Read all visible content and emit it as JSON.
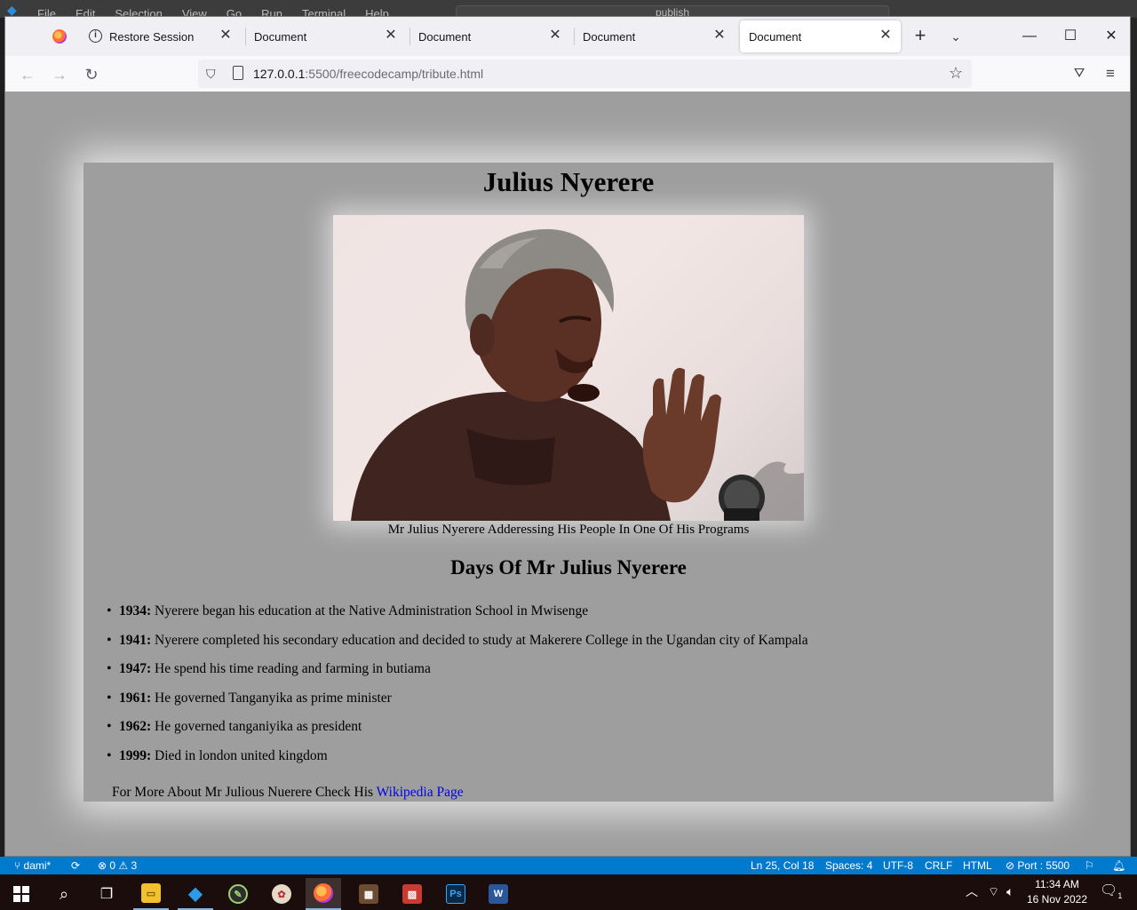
{
  "vscode": {
    "menu": [
      "File",
      "Edit",
      "Selection",
      "View",
      "Go",
      "Run",
      "Terminal",
      "Help"
    ],
    "search": "publish"
  },
  "browser": {
    "tabs": [
      {
        "label": "Restore Session"
      },
      {
        "label": "Document"
      },
      {
        "label": "Document"
      },
      {
        "label": "Document"
      },
      {
        "label": "Document",
        "active": true
      }
    ],
    "url_host": "127.0.0.1",
    "url_path": ":5500/freecodecamp/tribute.html"
  },
  "page": {
    "title": "Julius Nyerere",
    "image_caption": "Mr Julius Nyerere Adderessing His People In One Of His Programs",
    "subtitle": "Days Of Mr Julius Nyerere",
    "timeline": [
      {
        "year": "1934:",
        "text": " Nyerere began his education at the Native Administration School in Mwisenge"
      },
      {
        "year": "1941:",
        "text": " Nyerere completed his secondary education and decided to study at Makerere College in the Ugandan city of Kampala"
      },
      {
        "year": "1947:",
        "text": " He spend his time reading and farming in butiama"
      },
      {
        "year": "1961:",
        "text": " He governed Tanganyika as prime minister"
      },
      {
        "year": "1962:",
        "text": " He governed tanganiyika as president"
      },
      {
        "year": "1999:",
        "text": " Died in london united kingdom"
      }
    ],
    "more_text": "For More About Mr Julious Nuerere Check His ",
    "more_link": "Wikipedia Page",
    "link_color": "#0000ee",
    "background": "#9e9e9e"
  },
  "statusbar": {
    "branch": "dami*",
    "errors": "0",
    "warnings": "3",
    "position": "Ln 25, Col 18",
    "spaces": "Spaces: 4",
    "encoding": "UTF-8",
    "eol": "CRLF",
    "language": "HTML",
    "port": "Port : 5500"
  },
  "taskbar": {
    "time": "11:34 AM",
    "date": "16 Nov 2022",
    "notification_count": "1"
  }
}
